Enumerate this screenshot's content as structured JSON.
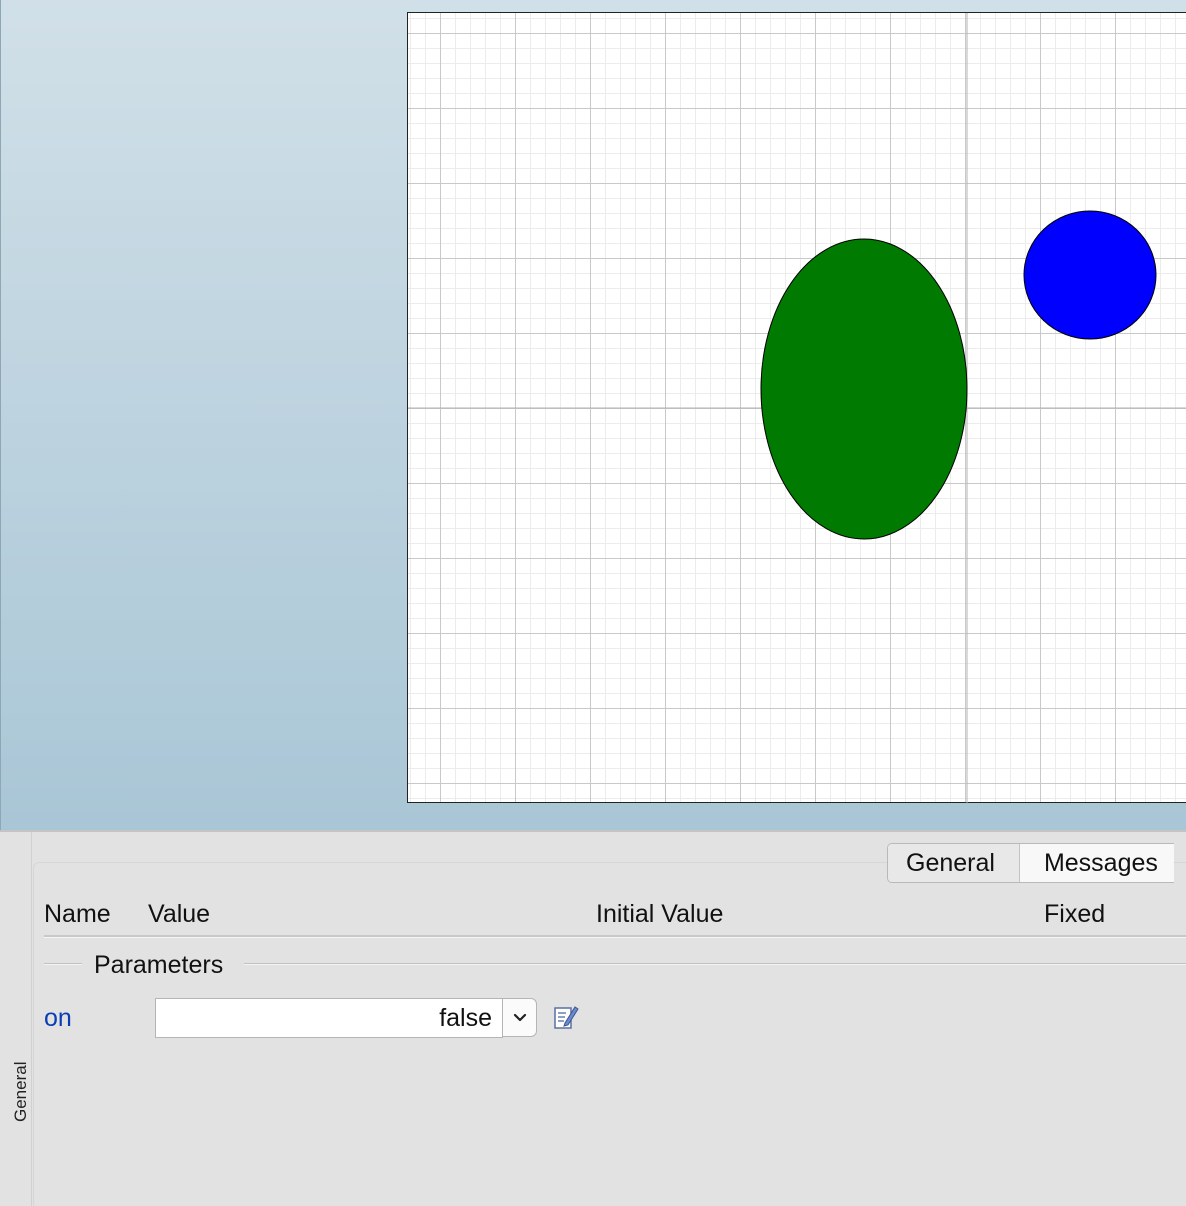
{
  "panel": {
    "side_tab_label": "General",
    "tabs": [
      {
        "label": "General",
        "active": true
      },
      {
        "label": "Messages",
        "active": false
      }
    ],
    "columns": {
      "name": "Name",
      "value": "Value",
      "initial_value": "Initial Value",
      "fixed": "Fixed"
    },
    "group_title": "Parameters",
    "parameter": {
      "name": "on",
      "value": "false"
    }
  },
  "diagram": {
    "shapes": [
      {
        "kind": "ellipse",
        "fill": "#007a00",
        "stroke": "#000000"
      },
      {
        "kind": "circle",
        "fill": "#0000ff",
        "stroke": "#000000"
      }
    ]
  },
  "icons": {
    "dropdown": "chevron-down-icon",
    "edit": "edit-icon"
  },
  "colors": {
    "parameter_name": "#0b3db5",
    "canvas_background": "#ffffff",
    "gradient_top": "#d1e0e8",
    "gradient_bottom": "#a9c6d6"
  }
}
